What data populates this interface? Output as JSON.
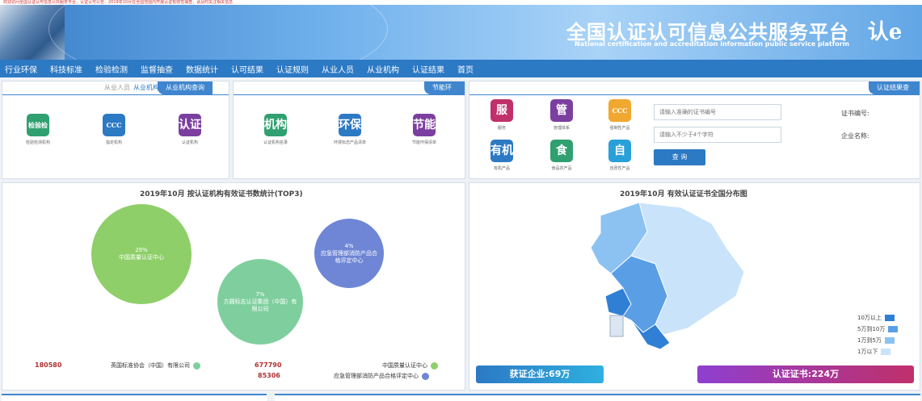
{
  "top_strip": "欢迎访问全国认证认可信息公共服务平台，认证认可公告：2019年10月在全国范围内开展认证有效性抽查，请及时关注相关信息",
  "header": {
    "title": "全国认证认可信息公共服务平台",
    "subtitle": "National certification and accreditation information public service platform",
    "logo_text": "认e云"
  },
  "nav": [
    "首页",
    "认证结果",
    "从业机构",
    "从业人员",
    "认证规则",
    "认可结果",
    "数据统计",
    "监督抽查",
    "检验检测",
    "科技标准",
    "行业环保"
  ],
  "query_panel": {
    "tab": "认证结果查询",
    "cert_label": "证书编号:",
    "cert_placeholder": "请输入准确的证书编号",
    "company_label": "企业名称:",
    "company_placeholder": "请输入不少于4个字符",
    "button": "查 询",
    "icons": [
      {
        "glyph": "CCC",
        "caption": "强制性产品",
        "color": "#f0a830",
        "name": "ccc-icon"
      },
      {
        "glyph": "管",
        "caption": "管理体系",
        "color": "#7b3fa0",
        "name": "management-icon"
      },
      {
        "glyph": "服",
        "caption": "服务",
        "color": "#c0306a",
        "name": "service-icon"
      },
      {
        "glyph": "自",
        "caption": "自愿性产品",
        "color": "#2aa0d8",
        "name": "voluntary-icon"
      },
      {
        "glyph": "食",
        "caption": "食品农产品",
        "color": "#30a070",
        "name": "food-icon"
      },
      {
        "glyph": "有机",
        "caption": "有机产品",
        "color": "#2c79c4",
        "name": "organic-icon"
      }
    ]
  },
  "env_panel": {
    "tab": "节能环保",
    "icons": [
      {
        "glyph": "节能",
        "caption": "节能环保清单",
        "color": "#7b3fa0",
        "name": "energy-saving-icon"
      },
      {
        "glyph": "环保",
        "caption": "环境标志产品清单",
        "color": "#2c79c4",
        "name": "eco-label-icon"
      },
      {
        "glyph": "机构",
        "caption": "认证机构名录",
        "color": "#30a070",
        "name": "institution-icon"
      }
    ]
  },
  "org_panel": {
    "tab": "从业机构查询",
    "tab2": "从业机构",
    "tab3": "从业人员",
    "icons": [
      {
        "glyph": "认证",
        "caption": "认证机构",
        "color": "#7b3fa0",
        "name": "cert-body-icon"
      },
      {
        "glyph": "CCC",
        "caption": "指定机构",
        "color": "#2c79c4",
        "name": "designated-icon"
      },
      {
        "glyph": "检验检测",
        "caption": "检验检测机构",
        "color": "#30a070",
        "name": "testing-icon"
      }
    ]
  },
  "map_section": {
    "title": "2019年10月  有效认证证书全国分布图",
    "legend": [
      "10万以上",
      "5万到10万",
      "1万到5万",
      "1万以下"
    ],
    "legend_colors": [
      "#2f7fd4",
      "#5a9fe6",
      "#8cc2f2",
      "#c9e3fb"
    ],
    "stat_cert": "认证证书:224万",
    "stat_company": "获证企业:69万"
  },
  "bubble_section": {
    "title": "2019年10月  按认证机构有效证书数统计(TOP3)",
    "bubbles": [
      {
        "pct": "29%",
        "name": "中国质量认证中心",
        "color": "#8fcf6a"
      },
      {
        "pct": "7%",
        "name": "方圆标志认证集团（中国）有限公司",
        "color": "#7fcf9e"
      },
      {
        "pct": "4%",
        "name": "应急管理部消防产品合格评定中心",
        "color": "#6f86d6"
      }
    ],
    "legend": [
      {
        "name": "中国质量认证中心",
        "value": "677790",
        "color": "#8fcf6a"
      },
      {
        "name": "应急管理部消防产品合格评定中心",
        "value": "85306",
        "color": "#6f86d6"
      },
      {
        "name": "英国标准协会（中国）有限公司",
        "value": "180580",
        "color": "#7fcf9e"
      }
    ]
  }
}
